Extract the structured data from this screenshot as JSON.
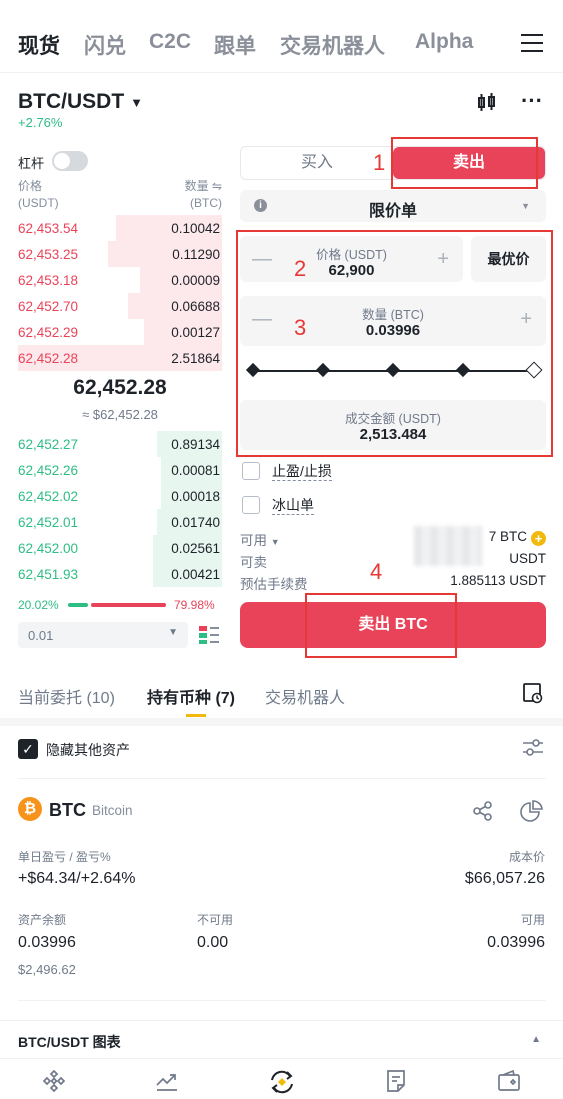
{
  "nav": {
    "tabs": [
      "现货",
      "闪兑",
      "C2C",
      "跟单",
      "交易机器人",
      "Alpha"
    ],
    "active": 0
  },
  "pair": {
    "symbol": "BTC/USDT",
    "change": "+2.76%"
  },
  "orderbook": {
    "leverage_label": "杠杆",
    "price_header": "价格",
    "price_unit": "(USDT)",
    "qty_header": "数量 ⇋",
    "qty_unit": "(BTC)",
    "asks": [
      {
        "price": "62,453.54",
        "qty": "0.10042",
        "depth": 0.52
      },
      {
        "price": "62,453.25",
        "qty": "0.11290",
        "depth": 0.56
      },
      {
        "price": "62,453.18",
        "qty": "0.00009",
        "depth": 0.4
      },
      {
        "price": "62,452.70",
        "qty": "0.06688",
        "depth": 0.46
      },
      {
        "price": "62,452.29",
        "qty": "0.00127",
        "depth": 0.38
      },
      {
        "price": "62,452.28",
        "qty": "2.51864",
        "depth": 1.0
      }
    ],
    "mid_price": "62,452.28",
    "mid_fiat": "≈ $62,452.28",
    "bids": [
      {
        "price": "62,452.27",
        "qty": "0.89134",
        "depth": 0.32
      },
      {
        "price": "62,452.26",
        "qty": "0.00081",
        "depth": 0.3
      },
      {
        "price": "62,452.02",
        "qty": "0.00018",
        "depth": 0.3
      },
      {
        "price": "62,452.01",
        "qty": "0.01740",
        "depth": 0.32
      },
      {
        "price": "62,452.00",
        "qty": "0.02561",
        "depth": 0.34
      },
      {
        "price": "62,451.93",
        "qty": "0.00421",
        "depth": 0.34
      }
    ],
    "buy_ratio": "20.02%",
    "sell_ratio": "79.98%",
    "buy_ratio_value": 20.02,
    "depth_value": "0.01"
  },
  "form": {
    "buy_label": "买入",
    "sell_label": "卖出",
    "order_type": "限价单",
    "price_label": "价格 (USDT)",
    "price_value": "62,900",
    "best_price_label": "最优价",
    "qty_label": "数量 (BTC)",
    "qty_value": "0.03996",
    "total_label": "成交金额 (USDT)",
    "total_value": "2,513.484",
    "tpsl_label": "止盈/止损",
    "iceberg_label": "冰山单",
    "available_label": "可用",
    "available_value": "7 BTC",
    "sellable_label": "可卖",
    "sellable_value": "USDT",
    "fee_label": "预估手续费",
    "fee_value": "1.885113 USDT",
    "submit_label": "卖出 BTC"
  },
  "annotations": [
    "1",
    "2",
    "3",
    "4"
  ],
  "bottom": {
    "tabs": [
      "当前委托 (10)",
      "持有币种 (7)",
      "交易机器人"
    ],
    "active": 1,
    "hide_label": "隐藏其他资产",
    "asset": {
      "symbol": "BTC",
      "name": "Bitcoin",
      "pnl_label": "单日盈亏 / 盈亏%",
      "pnl_value": "+$64.34/+2.64%",
      "cost_label": "成本价",
      "cost_value": "$66,057.26",
      "balance_label": "资产余额",
      "balance_value": "0.03996",
      "balance_fiat": "$2,496.62",
      "unavailable_label": "不可用",
      "unavailable_value": "0.00",
      "available_label": "可用",
      "available_value": "0.03996"
    },
    "chart_label": "BTC/USDT 图表"
  },
  "colors": {
    "sell": "#e94359",
    "buy": "#2ebd85",
    "accent": "#f0b90b",
    "annotation": "#e53935"
  }
}
